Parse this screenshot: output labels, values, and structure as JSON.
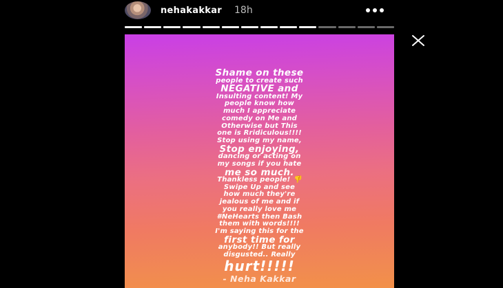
{
  "header": {
    "username": "nehakakkar",
    "timestamp": "18h",
    "more_icon": "more-horizontal-icon",
    "close_icon": "close-icon"
  },
  "progress": {
    "total_segments": 14,
    "completed_segments": 10
  },
  "story": {
    "background_top": "#c93fe6",
    "background_bottom": "#f29048",
    "lines": [
      {
        "text": "Shame on these",
        "size": "big"
      },
      {
        "text": "people to create such",
        "size": "normal"
      },
      {
        "text": "NEGATIVE and",
        "size": "big"
      },
      {
        "text": "Insulting content! My",
        "size": "normal"
      },
      {
        "text": "people know how",
        "size": "normal"
      },
      {
        "text": "much I appreciate",
        "size": "normal"
      },
      {
        "text": "comedy on Me and",
        "size": "normal"
      },
      {
        "text": "Otherwise  but This",
        "size": "normal"
      },
      {
        "text": "one is Rridiculous!!!!",
        "size": "normal"
      },
      {
        "text": "Stop using my name,",
        "size": "normal"
      },
      {
        "text": "Stop enjoying,",
        "size": "big"
      },
      {
        "text": "dancing or acting on",
        "size": "normal"
      },
      {
        "text": "my songs  if you hate",
        "size": "normal"
      },
      {
        "text": "me so much.",
        "size": "big"
      },
      {
        "text": "Thankless people! 👎",
        "size": "normal"
      },
      {
        "text": "Swipe Up and see",
        "size": "normal"
      },
      {
        "text": "how much they're",
        "size": "normal"
      },
      {
        "text": "jealous of me and if",
        "size": "normal"
      },
      {
        "text": "you really love me",
        "size": "normal"
      },
      {
        "text": "#NeHearts  then Bash",
        "size": "normal"
      },
      {
        "text": "them with words!!!!",
        "size": "normal"
      },
      {
        "text": "I'm saying this for the",
        "size": "normal"
      },
      {
        "text": "first time for",
        "size": "big"
      },
      {
        "text": "anybody!! But really",
        "size": "normal"
      },
      {
        "text": "disgusted.. Really",
        "size": "normal"
      },
      {
        "text": "hurt!!!!!",
        "size": "huge"
      },
      {
        "text": "- Neha Kakkar",
        "size": "sig"
      }
    ]
  }
}
